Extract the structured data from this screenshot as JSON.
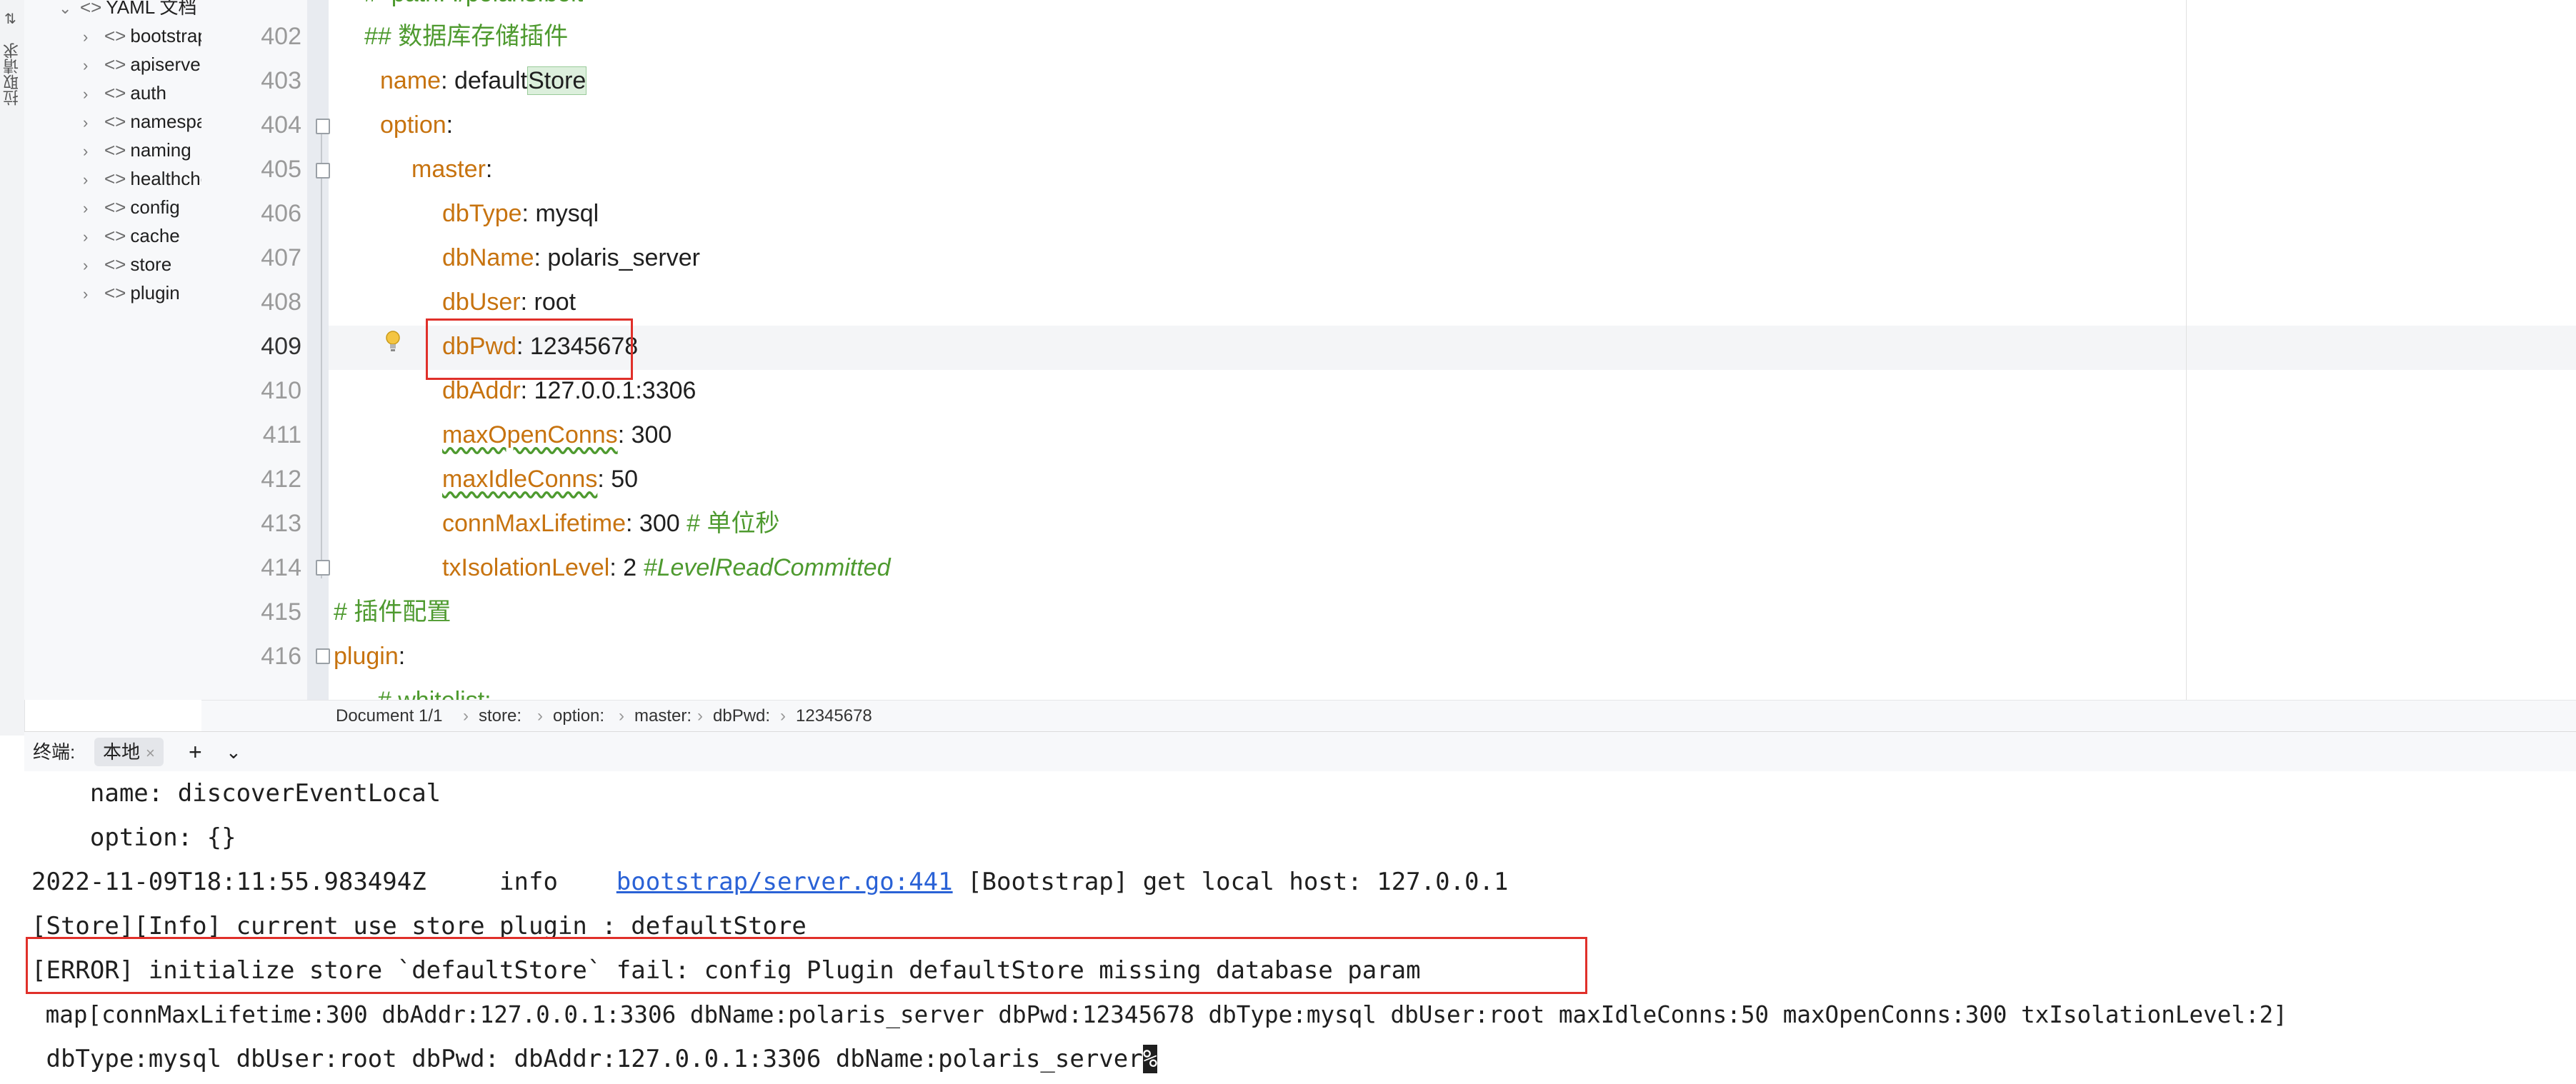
{
  "side_strip": {
    "label": "拉取请求"
  },
  "project_tree": {
    "root_label": "YAML 文档",
    "items": [
      "bootstrap",
      "apiservers",
      "auth",
      "namespace",
      "naming",
      "healthcheck",
      "config",
      "cache",
      "store",
      "plugin"
    ]
  },
  "editor": {
    "line_numbers": [
      "402",
      "403",
      "404",
      "405",
      "406",
      "407",
      "408",
      "409",
      "410",
      "411",
      "412",
      "413",
      "414",
      "415",
      "416"
    ],
    "top_partial_text": "#  path: ./polaris.bolt",
    "bottom_partial_text": "  # whitelist:",
    "lines": {
      "l402": "## 数据库存储插件",
      "l403_key": "name",
      "l403_val_a": "default",
      "l403_val_b": "Store",
      "l404_key": "option",
      "l405_key": "master",
      "l406_key": "dbType",
      "l406_val": "mysql",
      "l407_key": "dbName",
      "l407_val": "polaris_server",
      "l408_key": "dbUser",
      "l408_val": "root",
      "l409_key": "dbPwd",
      "l409_val": "12345678",
      "l410_key": "dbAddr",
      "l410_val": "127.0.0.1:3306",
      "l411_key": "maxOpenConns",
      "l411_val": "300",
      "l412_key": "maxIdleConns",
      "l412_val": "50",
      "l413_key": "connMaxLifetime",
      "l413_val": "300",
      "l413_comment": "# 单位秒",
      "l414_key": "txIsolationLevel",
      "l414_val": "2",
      "l414_comment": "#LevelReadCommitted",
      "l415": "# 插件配置",
      "l416_key": "plugin"
    }
  },
  "breadcrumb": [
    "Document 1/1",
    "store:",
    "option:",
    "master:",
    "dbPwd:",
    "12345678"
  ],
  "terminal_header": {
    "label": "终端:",
    "tab": "本地",
    "add": "+",
    "dropdown": "⌄"
  },
  "terminal": {
    "line1": "    name: discoverEventLocal",
    "line2": "    option: {}",
    "line3_prefix": "2022-11-09T18:11:55.983494Z     info    ",
    "line3_link": "bootstrap/server.go:441",
    "line3_suffix": " [Bootstrap] get local host: 127.0.0.1",
    "line4": "[Store][Info] current use store plugin : defaultStore",
    "line5": "[ERROR] initialize store `defaultStore` fail: config Plugin defaultStore missing database param",
    "line6": " map[connMaxLifetime:300 dbAddr:127.0.0.1:3306 dbName:polaris_server dbPwd:12345678 dbType:mysql dbUser:root maxIdleConns:50 maxOpenConns:300 txIsolationLevel:2]",
    "line7": " dbType:mysql dbUser:root dbPwd: dbAddr:127.0.0.1:3306 dbName:polaris_server",
    "line7_cursor": "%"
  },
  "colors": {
    "key": "#c7730f",
    "comment": "#4e9a2f",
    "highlight_box": "#e0302a",
    "link": "#2a62d6"
  }
}
